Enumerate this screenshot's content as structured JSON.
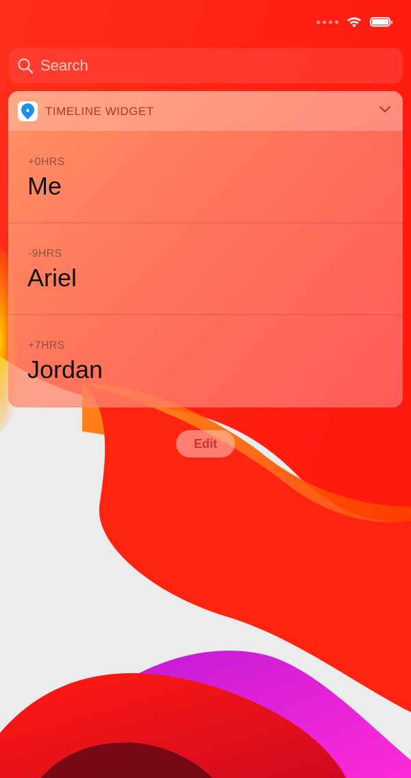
{
  "status_bar": {
    "icons": [
      "signal-dots-icon",
      "wifi-icon",
      "battery-icon"
    ],
    "battery_level": 1.0
  },
  "search": {
    "placeholder": "Search",
    "icon": "search-icon"
  },
  "widget": {
    "app_icon": "timeline-app-icon",
    "title": "TIMELINE WIDGET",
    "chevron_icon": "chevron-down-icon",
    "rows": [
      {
        "offset": "+0HRS",
        "name": "Me"
      },
      {
        "offset": "-9HRS",
        "name": "Ariel"
      },
      {
        "offset": "+7HRS",
        "name": "Jordan"
      }
    ]
  },
  "edit_button": {
    "label": "Edit"
  },
  "colors": {
    "accent": "#c7362a",
    "wallpaper_red": "#ff2a14",
    "wallpaper_magenta": "#e81cf0"
  }
}
